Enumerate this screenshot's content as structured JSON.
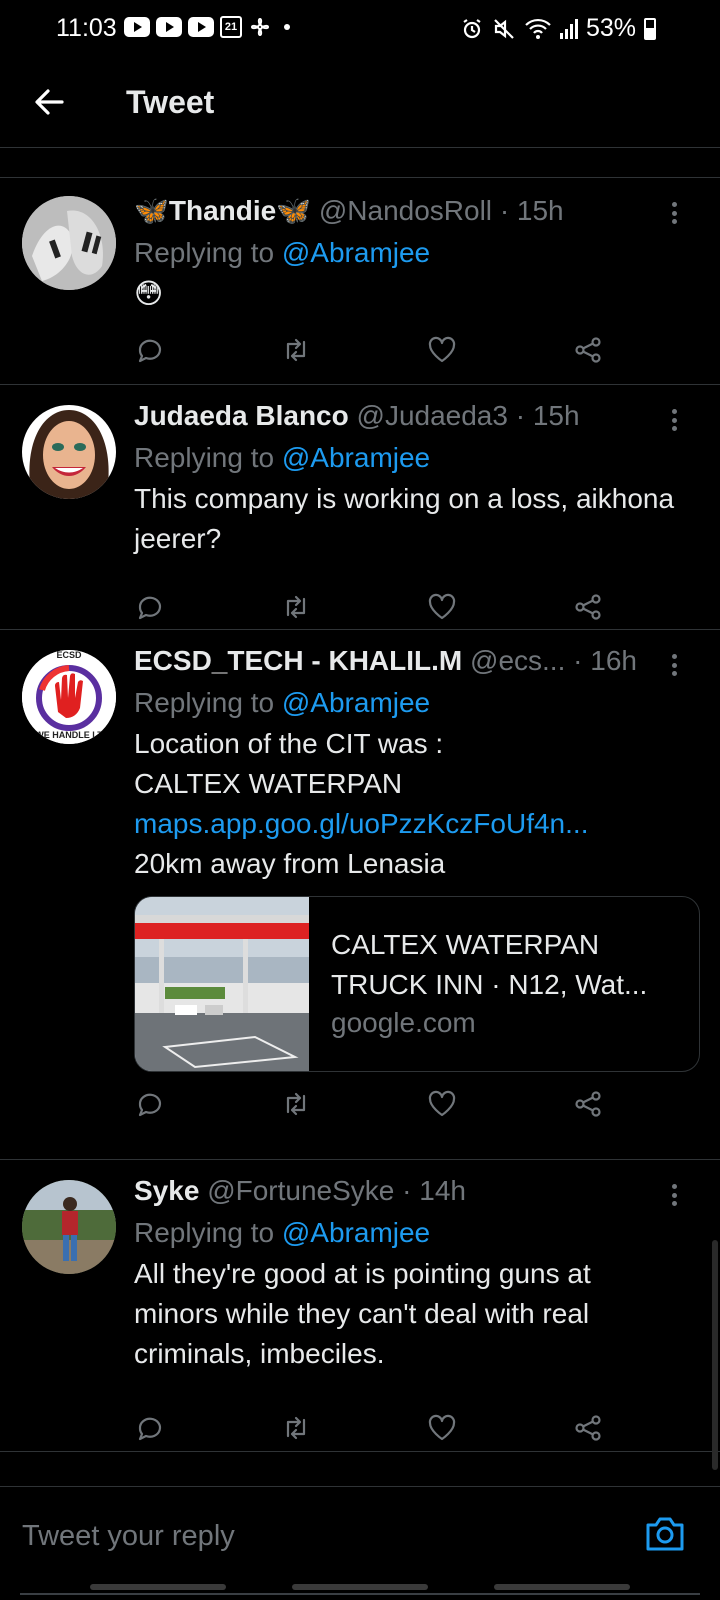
{
  "status": {
    "time": "11:03",
    "calendar_day": "21",
    "battery": "53%",
    "battery_level": 0.53,
    "icons_left": [
      "youtube-icon",
      "youtube-icon",
      "youtube-icon",
      "calendar-icon",
      "fan-icon",
      "dot-icon"
    ],
    "icons_right": [
      "alarm-icon",
      "mute-icon",
      "wifi-icon",
      "signal-icon",
      "battery-icon"
    ]
  },
  "header": {
    "title": "Tweet"
  },
  "tweets": [
    {
      "name": "🦋Thandie🦋",
      "handle": "@NandosRoll",
      "time": "· 15h",
      "replying": "Replying to ",
      "mention": "@Abramjee",
      "text": "😳"
    },
    {
      "name": "Judaeda Blanco",
      "handle": "@Judaeda3",
      "time": "· 15h",
      "replying": "Replying to ",
      "mention": "@Abramjee",
      "text": "This company is working on a loss, aikhona jeerer?"
    },
    {
      "name": "ECSD_TECH - KHALIL.M",
      "handle": "@ecs...",
      "time": "· 16h",
      "replying": "Replying to ",
      "mention": "@Abramjee",
      "text_lines": [
        "Location of the CIT was :",
        "CALTEX WATERPAN"
      ],
      "link": "maps.app.goo.gl/uoPzzKczFoUf4n...",
      "text_after": "20km away from Lenasia",
      "avatar_text_top": "ECSD",
      "avatar_text_bottom": "WE HANDLE I.T",
      "card": {
        "title_line1": "CALTEX WATERPAN",
        "title_line2": "TRUCK INN · N12, Wat...",
        "domain": "google.com"
      }
    },
    {
      "name": "Syke",
      "handle": "@FortuneSyke",
      "time": "· 14h",
      "replying": "Replying to ",
      "mention": "@Abramjee",
      "text": "All they're good at is pointing guns at minors while they can't deal with real criminals, imbeciles."
    }
  ],
  "compose": {
    "placeholder": "Tweet your reply"
  },
  "colors": {
    "background": "#000000",
    "accent": "#1d9bf0",
    "muted": "#71767b",
    "text": "#e7e9ea",
    "divider": "#2f3336"
  }
}
